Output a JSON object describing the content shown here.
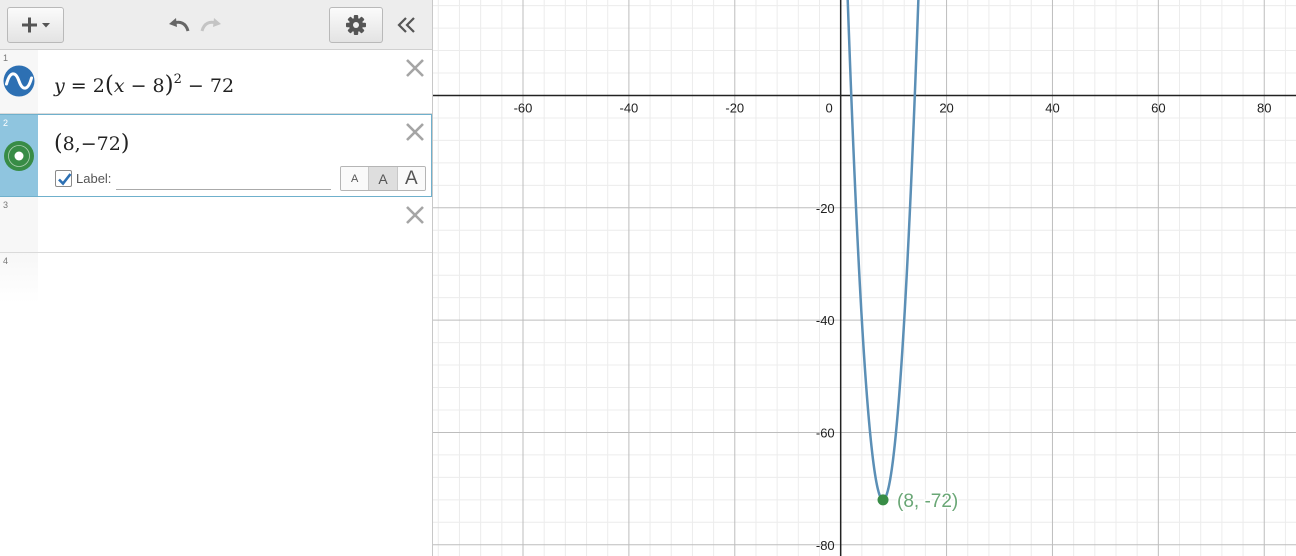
{
  "toolbar": {
    "add": "add-expression",
    "undo": "undo",
    "redo": "redo",
    "settings": "graph-settings",
    "collapse": "hide-expression-list"
  },
  "expressions": [
    {
      "index": "1",
      "type": "equation",
      "latex": "y=2(x-8)^2-72",
      "color": "#2d70b3"
    },
    {
      "index": "2",
      "type": "point",
      "latex": "(8,-72)",
      "color": "#388c46",
      "show_label": true,
      "label_text": "Label:",
      "label_value": "",
      "label_sizes": [
        "A",
        "A",
        "A"
      ],
      "selected_label_size": "medium"
    },
    {
      "index": "3",
      "type": "empty"
    },
    {
      "index": "4",
      "type": "empty"
    }
  ],
  "colors": {
    "curve": "#5b8fb6",
    "point": "#388c46",
    "point_label": "#6aa776",
    "selected_row": "#8fc5df"
  },
  "chart_data": {
    "type": "line",
    "xlim": [
      -77,
      86
    ],
    "ylim": [
      -82,
      17
    ],
    "x_ticks": [
      -60,
      -40,
      -20,
      0,
      20,
      40,
      60,
      80
    ],
    "y_ticks": [
      -20,
      -40,
      -60,
      -80
    ],
    "x_tick_labels": [
      "-60",
      "-40",
      "-20",
      "0",
      "20",
      "40",
      "60",
      "80"
    ],
    "y_tick_labels": [
      "-20",
      "-40",
      "-60",
      "-80"
    ],
    "grid": true,
    "minor_grid_step": 4,
    "major_grid_step": 20,
    "curve": {
      "a": 2,
      "h": 8,
      "k": -72
    },
    "point": {
      "x": 8,
      "y": -72,
      "label": "(8, -72)"
    }
  }
}
